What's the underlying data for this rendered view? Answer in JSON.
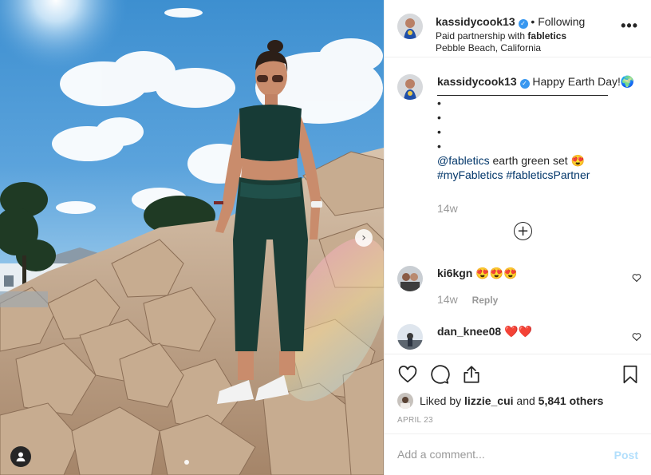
{
  "post": {
    "author": "kassidycook13",
    "follow_status": "• Following",
    "partnership_prefix": "Paid partnership with",
    "partner": "fabletics",
    "location": "Pebble Beach, California"
  },
  "caption": {
    "author": "kassidycook13",
    "text": "Happy Earth Day!🌍",
    "bullets": [
      "•",
      "•",
      "•",
      "•"
    ],
    "mention": "@fabletics",
    "mention_text": "earth green set 😍",
    "hashtags": "#myFabletics #fableticsPartner",
    "time": "14w"
  },
  "comments": [
    {
      "user": "ki6kgn",
      "text": "😍😍😍",
      "time": "14w",
      "reply_label": "Reply"
    },
    {
      "user": "dan_knee08",
      "text": "❤️❤️"
    }
  ],
  "likes": {
    "liked_by_prefix": "Liked by",
    "liked_by_user": "lizzie_cui",
    "and_text": "and",
    "others": "5,841 others"
  },
  "date": "APRIL 23",
  "composer": {
    "placeholder": "Add a comment...",
    "post_label": "Post"
  },
  "icons": {
    "more": "more-options-icon",
    "verified": "verified-badge-icon",
    "like": "heart-icon",
    "comment": "comment-icon",
    "share": "share-icon",
    "save": "bookmark-icon",
    "next": "chevron-right-icon",
    "tag": "user-tag-icon",
    "load_more": "plus-circle-icon"
  },
  "colors": {
    "link": "#003569",
    "verified": "#3897f0",
    "muted": "#999999",
    "post_disabled": "#b2dffc",
    "like_red": "#ed4956"
  }
}
